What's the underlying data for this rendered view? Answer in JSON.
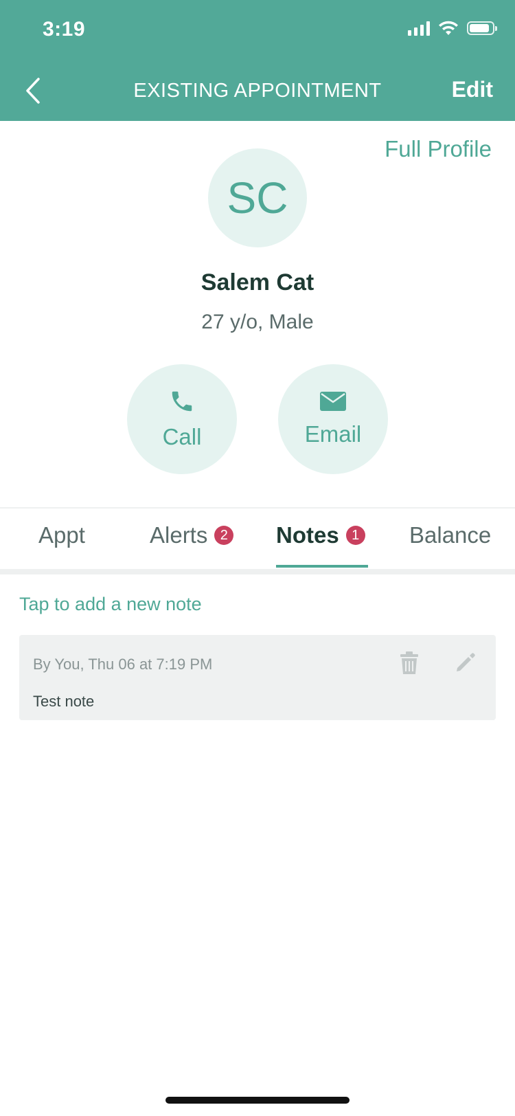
{
  "status_bar": {
    "time": "3:19",
    "icons": [
      "signal-icon",
      "wifi-icon",
      "battery-icon"
    ]
  },
  "nav": {
    "back_icon": "chevron-left-icon",
    "title": "EXISTING APPOINTMENT",
    "edit_label": "Edit"
  },
  "profile": {
    "full_profile_label": "Full Profile",
    "initials": "SC",
    "name": "Salem Cat",
    "details": "27 y/o, Male"
  },
  "actions": [
    {
      "label": "Call",
      "icon": "phone-icon"
    },
    {
      "label": "Email",
      "icon": "envelope-icon"
    }
  ],
  "tabs": [
    {
      "label": "Appt",
      "badge": null,
      "active": false
    },
    {
      "label": "Alerts",
      "badge": "2",
      "active": false
    },
    {
      "label": "Notes",
      "badge": "1",
      "active": true
    },
    {
      "label": "Balance",
      "badge": null,
      "active": false
    }
  ],
  "notes": {
    "add_prompt": "Tap to add a new note",
    "items": [
      {
        "meta": "By You, Thu 06 at 7:19 PM",
        "text": "Test note"
      }
    ]
  },
  "colors": {
    "header": "#52a998",
    "accent": "#4fa896",
    "accent_light": "#e5f3f0",
    "badge": "#c9405e",
    "text_dark": "#1e3a33"
  }
}
